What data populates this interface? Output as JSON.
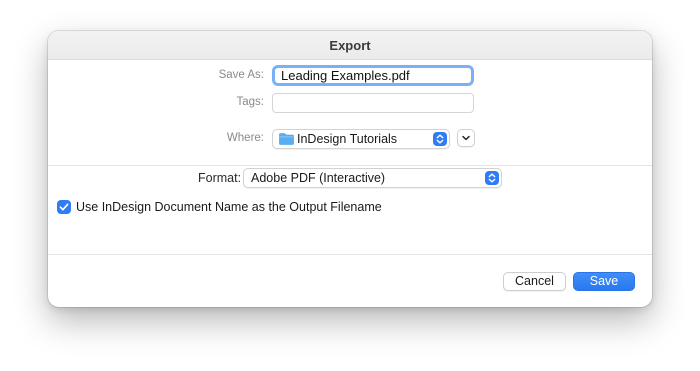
{
  "dialog": {
    "title": "Export"
  },
  "save_as": {
    "label": "Save As:",
    "value": "Leading Examples.pdf"
  },
  "tags": {
    "label": "Tags:",
    "value": ""
  },
  "where": {
    "label": "Where:",
    "selected": "InDesign Tutorials",
    "icon": "folder-icon"
  },
  "format": {
    "label": "Format:",
    "selected": "Adobe PDF (Interactive)"
  },
  "options": {
    "use_document_name": {
      "label": "Use InDesign Document Name as the Output Filename",
      "checked": true
    }
  },
  "buttons": {
    "cancel": "Cancel",
    "save": "Save"
  },
  "colors": {
    "accent": "#2f7cf6",
    "focus_ring": "#7ab0f5",
    "folder": "#5aaef0"
  }
}
